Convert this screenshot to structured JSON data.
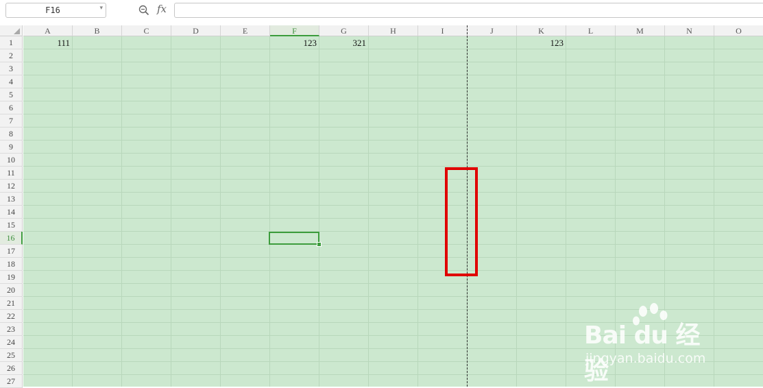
{
  "formula_bar": {
    "name_box": "F16",
    "fx_label": "fx",
    "formula": ""
  },
  "sheet": {
    "columns": [
      "A",
      "B",
      "C",
      "D",
      "E",
      "F",
      "G",
      "H",
      "I",
      "J",
      "K",
      "L",
      "M",
      "N",
      "O"
    ],
    "rows": [
      "1",
      "2",
      "3",
      "4",
      "5",
      "6",
      "7",
      "8",
      "9",
      "10",
      "11",
      "12",
      "13",
      "14",
      "15",
      "16",
      "17",
      "18",
      "19",
      "20",
      "21",
      "22",
      "23",
      "24",
      "25",
      "26",
      "27"
    ],
    "selected_column": "F",
    "selected_row": "16",
    "active_cell": "F16",
    "cells": [
      {
        "ref": "A1",
        "value": "111"
      },
      {
        "ref": "F1",
        "value": "123"
      },
      {
        "ref": "G1",
        "value": "321"
      },
      {
        "ref": "K1",
        "value": "123"
      }
    ],
    "cell_background": "#cce8cf",
    "selection_color": "#3c9c3c",
    "annotation_color": "#e00000"
  },
  "watermark": {
    "logo": "Bai du 经验",
    "url": "jingyan.baidu.com"
  }
}
